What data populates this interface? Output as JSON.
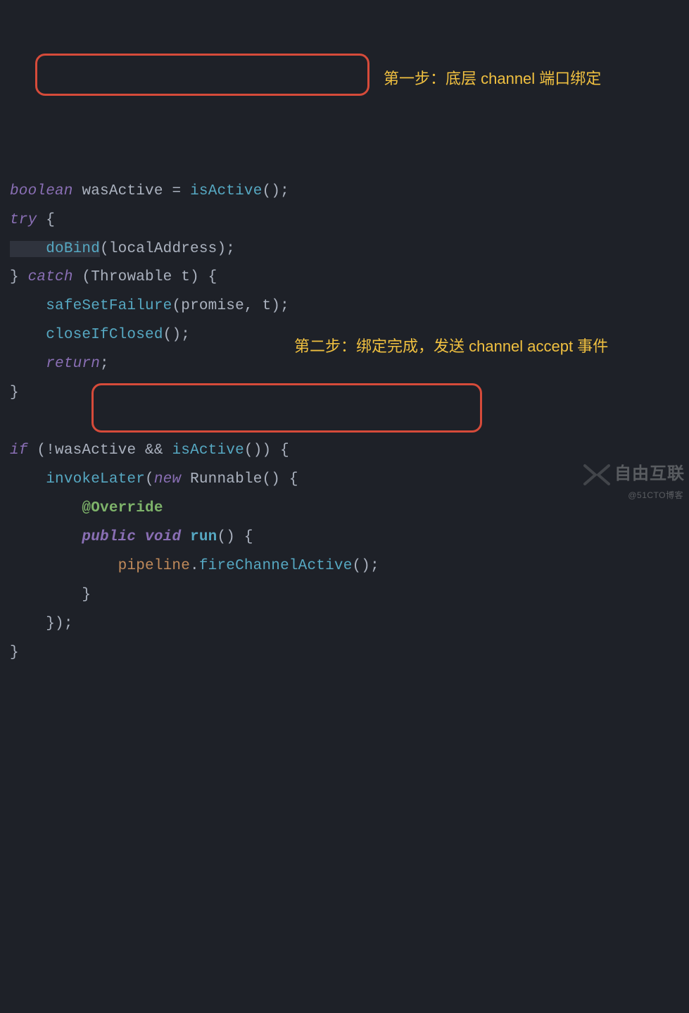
{
  "code": {
    "line1": {
      "kw": "boolean",
      "var": "wasActive",
      "op": "=",
      "call": "isActive",
      "paren": "()",
      "semi": ";"
    },
    "line2": {
      "kw": "try",
      "brace": " {"
    },
    "line3": {
      "indent": "    ",
      "call": "doBind",
      "open": "(",
      "arg": "localAddress",
      "close": ")",
      "semi": ";"
    },
    "line4": {
      "close": "} ",
      "kw": "catch",
      "open": " (",
      "type": "Throwable",
      "var": " t",
      "closep": ") {"
    },
    "line5": {
      "indent": "    ",
      "call": "safeSetFailure",
      "open": "(",
      "arg1": "promise",
      "comma": ", ",
      "arg2": "t",
      "close": ")",
      "semi": ";"
    },
    "line6": {
      "indent": "    ",
      "call": "closeIfClosed",
      "paren": "()",
      "semi": ";"
    },
    "line7": {
      "indent": "    ",
      "kw": "return",
      "semi": ";"
    },
    "line8": {
      "close": "}"
    },
    "line9": "",
    "line10": {
      "kw": "if",
      "open": " (",
      "bang": "!",
      "var1": "wasActive",
      "and": " && ",
      "call": "isActive",
      "paren": "()",
      "close": ") {"
    },
    "line11": {
      "indent": "    ",
      "call": "invokeLater",
      "open": "(",
      "kw": "new",
      "sp": " ",
      "type": "Runnable",
      "paren": "()",
      "brace": " {"
    },
    "line12": {
      "indent": "        ",
      "anno": "@Override"
    },
    "line13": {
      "indent": "        ",
      "kw1": "public",
      "sp1": " ",
      "kw2": "void",
      "sp2": " ",
      "call": "run",
      "paren": "()",
      "brace": " {"
    },
    "line14": {
      "indent": "            ",
      "field": "pipeline",
      "dot": ".",
      "call": "fireChannelActive",
      "paren": "()",
      "semi": ";"
    },
    "line15": {
      "indent": "        ",
      "close": "}"
    },
    "line16": {
      "indent": "    ",
      "close": "});"
    },
    "line17": {
      "close": "}"
    }
  },
  "annotations": {
    "step1": "第一步：底层 channel 端口绑定",
    "step2": "第二步：绑定完成，发送 channel accept 事件"
  },
  "watermark": {
    "brand": "自由互联",
    "sub": "@51CTO博客"
  }
}
